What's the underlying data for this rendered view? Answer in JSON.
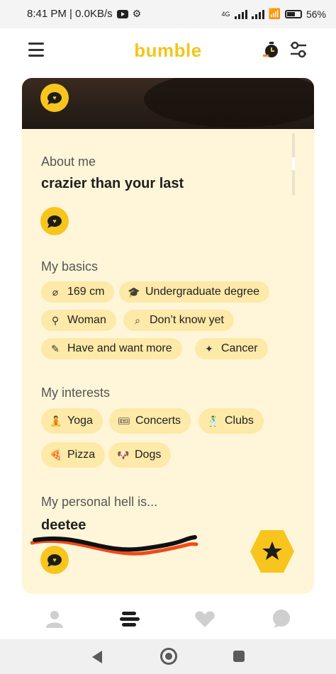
{
  "status_bar": {
    "time_speed": "8:41 PM | 0.0KB/s",
    "network_label": "4G",
    "battery": "56%"
  },
  "app": {
    "brand": "bumble"
  },
  "profile": {
    "about_title": "About me",
    "about_text": "crazier than your last",
    "basics_title": "My basics",
    "basics": [
      {
        "icon": "ruler-icon",
        "glyph": "⌀",
        "label": "169 cm"
      },
      {
        "icon": "graduation-cap-icon",
        "glyph": "🎓",
        "label": "Undergraduate degree"
      },
      {
        "icon": "gender-icon",
        "glyph": "⚲",
        "label": "Woman"
      },
      {
        "icon": "search-icon",
        "glyph": "⌕",
        "label": "Don’t know yet"
      },
      {
        "icon": "pacifier-icon",
        "glyph": "✎",
        "label": "Have and want more"
      },
      {
        "icon": "zodiac-icon",
        "glyph": "✦",
        "label": "Cancer"
      }
    ],
    "interests_title": "My interests",
    "interests": [
      {
        "emoji": "🧘",
        "label": "Yoga"
      },
      {
        "emoji": "🎟",
        "label": "Concerts"
      },
      {
        "emoji": "🕺",
        "label": "Clubs"
      },
      {
        "emoji": "🍕",
        "label": "Pizza"
      },
      {
        "emoji": "🐶",
        "label": "Dogs"
      }
    ],
    "prompt_title": "My personal hell is...",
    "prompt_answer": "deetee"
  },
  "colors": {
    "brand_yellow": "#f5c518",
    "card_bg": "#fff6d9",
    "chip_bg": "#fde9a8"
  }
}
